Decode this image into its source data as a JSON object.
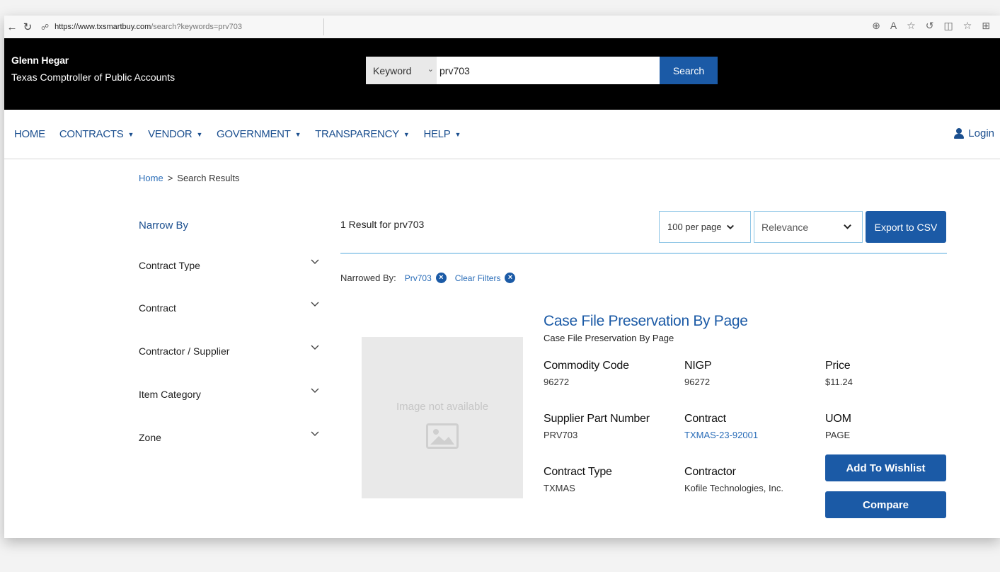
{
  "browser": {
    "url_host": "https://www.txsmartbuy.com",
    "url_path": "/search?keywords=prv703"
  },
  "header": {
    "name": "Glenn Hegar",
    "org": "Texas Comptroller of Public Accounts",
    "search_type": "Keyword",
    "search_value": "prv703",
    "search_button": "Search"
  },
  "nav": {
    "items": [
      {
        "label": "HOME",
        "dropdown": false
      },
      {
        "label": "CONTRACTS",
        "dropdown": true
      },
      {
        "label": "VENDOR",
        "dropdown": true
      },
      {
        "label": "GOVERNMENT",
        "dropdown": true
      },
      {
        "label": "TRANSPARENCY",
        "dropdown": true
      },
      {
        "label": "HELP",
        "dropdown": true
      }
    ],
    "login": "Login"
  },
  "breadcrumb": {
    "home": "Home",
    "separator": ">",
    "current": "Search Results"
  },
  "sidebar": {
    "title": "Narrow By",
    "filters": [
      "Contract Type",
      "Contract",
      "Contractor / Supplier",
      "Item Category",
      "Zone"
    ]
  },
  "results": {
    "count_text": "1 Result for prv703",
    "per_page": "100 per page",
    "sort": "Relevance",
    "export": "Export to CSV",
    "narrowed_label": "Narrowed By:",
    "chip": "Prv703",
    "clear": "Clear Filters"
  },
  "product": {
    "image_text": "Image not available",
    "title": "Case File Preservation By Page",
    "subtitle": "Case File Preservation By Page",
    "commodity_code_label": "Commodity Code",
    "commodity_code": "96272",
    "nigp_label": "NIGP",
    "nigp": "96272",
    "price_label": "Price",
    "price": "$11.24",
    "part_label": "Supplier Part Number",
    "part": "PRV703",
    "contract_label": "Contract",
    "contract": "TXMAS-23-92001",
    "uom_label": "UOM",
    "uom": "PAGE",
    "contract_type_label": "Contract Type",
    "contract_type": "TXMAS",
    "contractor_label": "Contractor",
    "contractor": "Kofile Technologies, Inc.",
    "wishlist": "Add To Wishlist",
    "compare": "Compare"
  },
  "colors": {
    "primary": "#1b5aa6",
    "link": "#2a6db8",
    "header_bg": "#000000",
    "accent_border": "#8fc6e6"
  }
}
